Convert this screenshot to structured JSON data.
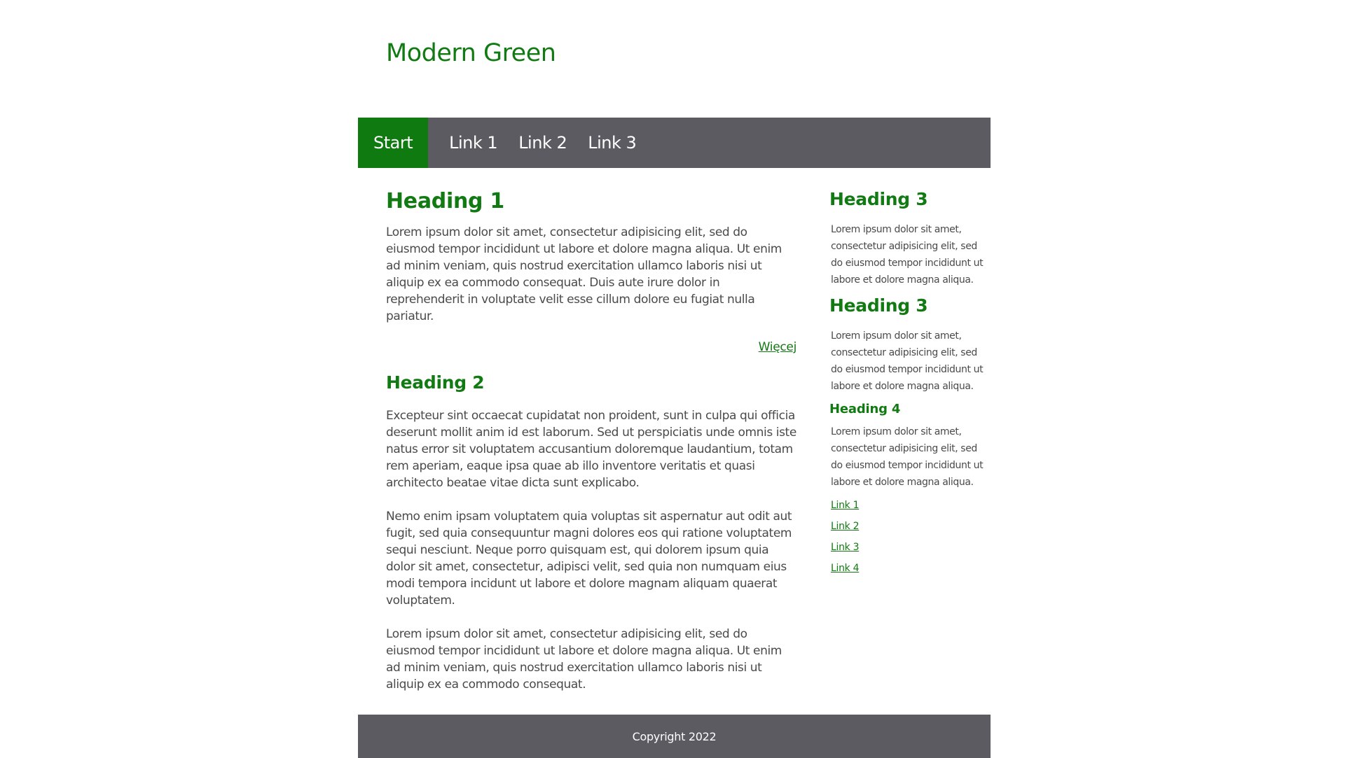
{
  "site": {
    "title": "Modern Green"
  },
  "nav": {
    "items": [
      {
        "label": "Start",
        "active": true
      },
      {
        "label": "Link 1",
        "active": false
      },
      {
        "label": "Link 2",
        "active": false
      },
      {
        "label": "Link 3",
        "active": false
      }
    ]
  },
  "main": {
    "heading1": "Heading 1",
    "intro": "Lorem ipsum dolor sit amet, consectetur adipisicing elit, sed do eiusmod tempor incididunt ut labore et dolore magna aliqua. Ut enim ad minim veniam, quis nostrud exercitation ullamco laboris nisi ut aliquip ex ea commodo consequat. Duis aute irure dolor in reprehenderit in voluptate velit esse cillum dolore eu fugiat nulla pariatur.",
    "more_label": "Więcej",
    "heading2": "Heading 2",
    "paragraphs": [
      "Excepteur sint occaecat cupidatat non proident, sunt in culpa qui officia deserunt mollit anim id est laborum. Sed ut perspiciatis unde omnis iste natus error sit voluptatem accusantium doloremque laudantium, totam rem aperiam, eaque ipsa quae ab illo inventore veritatis et quasi architecto beatae vitae dicta sunt explicabo.",
      "Nemo enim ipsam voluptatem quia voluptas sit aspernatur aut odit aut fugit, sed quia consequuntur magni dolores eos qui ratione voluptatem sequi nesciunt. Neque porro quisquam est, qui dolorem ipsum quia dolor sit amet, consectetur, adipisci velit, sed quia non numquam eius modi tempora incidunt ut labore et dolore magnam aliquam quaerat voluptatem.",
      "Lorem ipsum dolor sit amet, consectetur adipisicing elit, sed do eiusmod tempor incididunt ut labore et dolore magna aliqua. Ut enim ad minim veniam, quis nostrud exercitation ullamco laboris nisi ut aliquip ex ea commodo consequat."
    ]
  },
  "sidebar": {
    "sections": [
      {
        "heading": "Heading 3",
        "text": "Lorem ipsum dolor sit amet, consectetur adipisicing elit, sed do eiusmod tempor incididunt ut labore et dolore magna aliqua."
      },
      {
        "heading": "Heading 3",
        "text": "Lorem ipsum dolor sit amet, consectetur adipisicing elit, sed do eiusmod tempor incididunt ut labore et dolore magna aliqua."
      },
      {
        "heading": "Heading 4",
        "text": "Lorem ipsum dolor sit amet, consectetur adipisicing elit, sed do eiusmod tempor incididunt ut labore et dolore magna aliqua."
      }
    ],
    "links": [
      "Link 1",
      "Link 2",
      "Link 3",
      "Link 4"
    ]
  },
  "footer": {
    "copyright": "Copyright 2022"
  },
  "colors": {
    "accent": "#117a12",
    "nav_active": "#0f7a10",
    "bar_background": "#5b5b61",
    "text": "#4a4a4a"
  }
}
